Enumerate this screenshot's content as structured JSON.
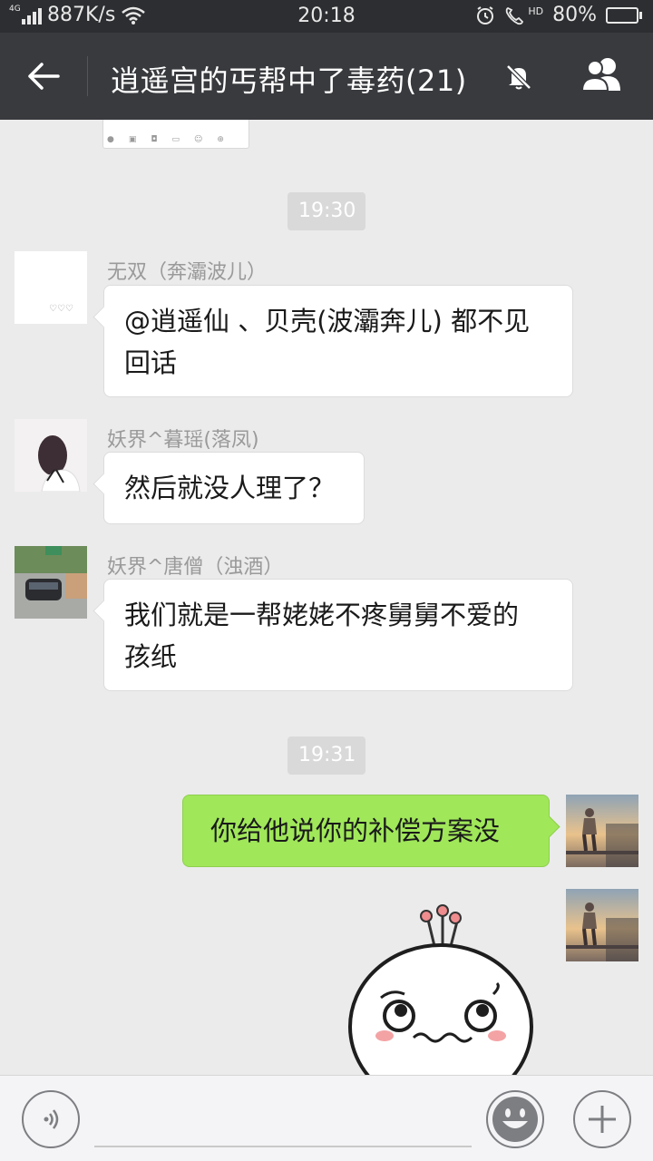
{
  "status_bar": {
    "network": "4G",
    "speed": "887K/s",
    "time": "20:18",
    "hd": "HD",
    "battery": "80%",
    "battery_level": 0.8
  },
  "header": {
    "title": "逍遥宫的丐帮中了毒药(21)"
  },
  "messages": [
    {
      "time": "19:30"
    },
    {
      "sender": "无双（奔灞波儿）",
      "line1": "@逍遥仙 、贝壳(波灞奔儿) 都不见",
      "line2": "回话",
      "avatar_text": "♡♡♡"
    },
    {
      "sender": "妖界^暮瑶(落凤)",
      "line1": "然后就没人理了？"
    },
    {
      "sender": "妖界^唐僧（浊酒）",
      "line1": "我们就是一帮姥姥不疼舅舅不爱的",
      "line2": "孩纸"
    },
    {
      "time": "19:31"
    },
    {
      "line1": "你给他说你的补偿方案没"
    }
  ],
  "icons": {
    "back": "back-arrow-icon",
    "mute": "mute-bell-icon",
    "members": "group-members-icon",
    "voice": "voice-icon",
    "emoji": "emoji-icon",
    "more": "plus-icon"
  },
  "colors": {
    "header_bg": "#393a3e",
    "my_bubble": "#a0e75a",
    "battery_fill": "#3fcf47"
  }
}
